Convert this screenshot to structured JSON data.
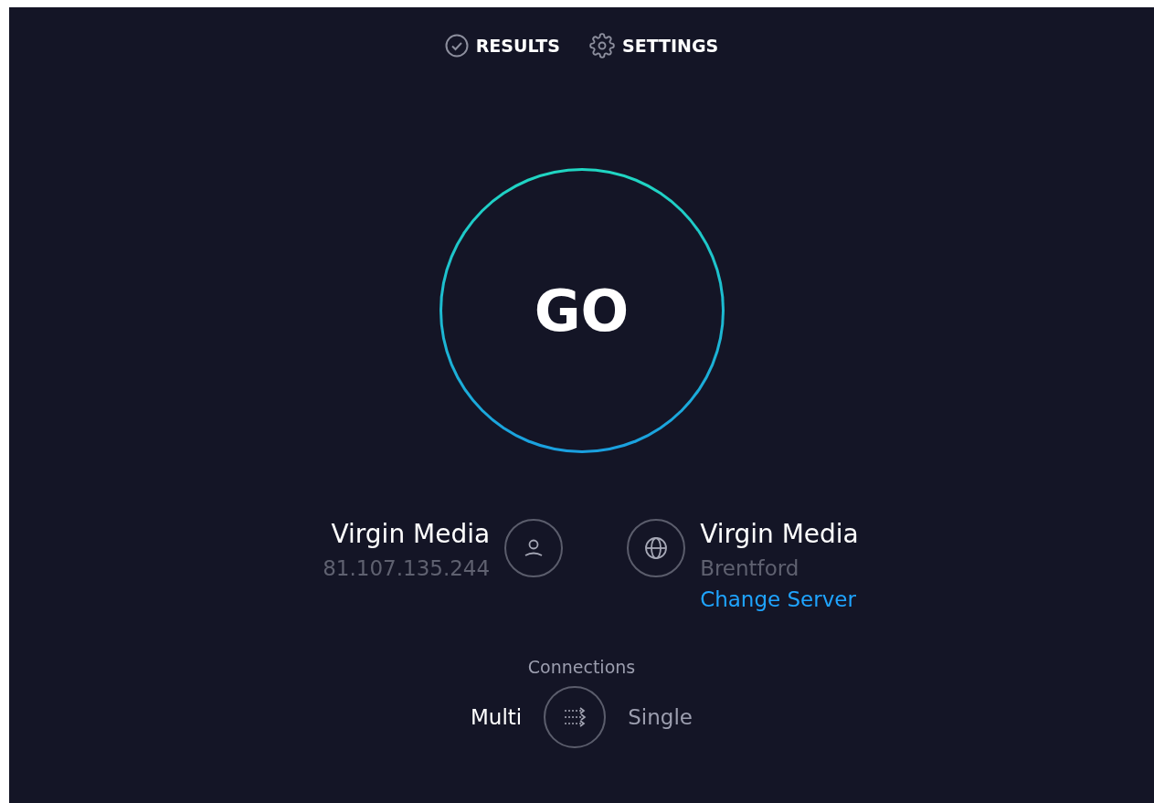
{
  "nav": [
    {
      "kind": "results",
      "label": "RESULTS"
    },
    {
      "kind": "settings",
      "label": "SETTINGS"
    }
  ],
  "start_button": {
    "label": "GO"
  },
  "client": {
    "name": "Virgin Media",
    "ip": "81.107.135.244"
  },
  "server": {
    "name": "Virgin Media",
    "location": "Brentford",
    "link": "Change Server"
  },
  "connections": {
    "title": "Connections",
    "options": [
      {
        "label": "Multi",
        "selected": true
      },
      {
        "label": "Single",
        "selected": false
      }
    ]
  }
}
